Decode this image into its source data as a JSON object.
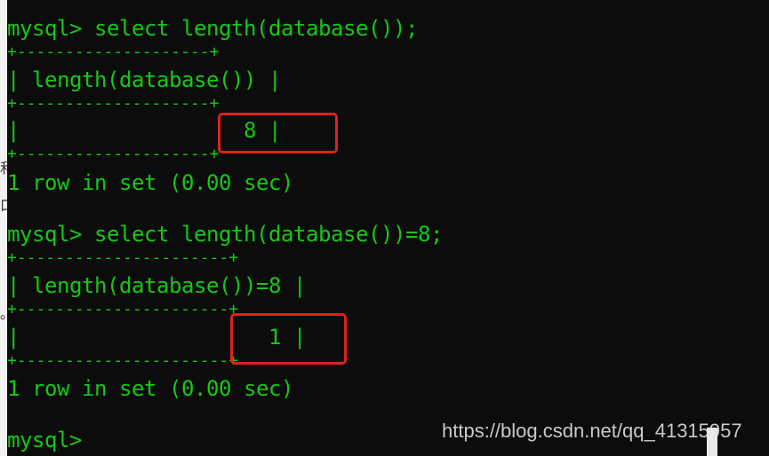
{
  "terminal": {
    "lines": [
      {
        "text": "mysql> select length(database());"
      },
      {
        "text": "+--------------------+"
      },
      {
        "text": "| length(database()) |"
      },
      {
        "text": "+--------------------+"
      },
      {
        "text": "|                  8 |"
      },
      {
        "text": "+--------------------+"
      },
      {
        "text": "1 row in set (0.00 sec)"
      },
      {
        "text": ""
      },
      {
        "text": "mysql> select length(database())=8;"
      },
      {
        "text": "+----------------------+"
      },
      {
        "text": "| length(database())=8 |"
      },
      {
        "text": "+----------------------+"
      },
      {
        "text": "|                    1 |"
      },
      {
        "text": "+----------------------+"
      },
      {
        "text": "1 row in set (0.00 sec)"
      },
      {
        "text": ""
      },
      {
        "text": "mysql>"
      }
    ]
  },
  "left_edge_glyphs": [
    "和",
    "口",
    "。"
  ],
  "watermark": "https://blog.csdn.net/qq_41315957",
  "colors": {
    "text": "#13c913",
    "background": "#0c0c0c",
    "highlight": "#e0201c"
  }
}
